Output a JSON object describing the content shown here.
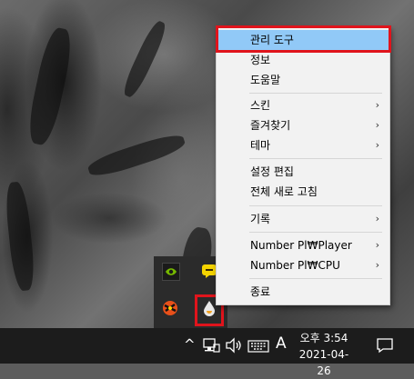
{
  "context_menu": {
    "items": [
      {
        "label": "관리 도구",
        "submenu": false,
        "highlighted": true
      },
      {
        "label": "정보",
        "submenu": false
      },
      {
        "label": "도움말",
        "submenu": false
      },
      {
        "label": "스킨",
        "submenu": true
      },
      {
        "label": "즐겨찾기",
        "submenu": true
      },
      {
        "label": "테마",
        "submenu": true
      },
      {
        "label": "설정 편집",
        "submenu": false
      },
      {
        "label": "전체 새로 고침",
        "submenu": false
      },
      {
        "label": "기록",
        "submenu": true
      },
      {
        "label": "Number Pl₩Player",
        "submenu": true
      },
      {
        "label": "Number Pl₩CPU",
        "submenu": true
      },
      {
        "label": "종료",
        "submenu": false
      }
    ],
    "submenu_arrow": "›",
    "highlight_color": "#91c9f7"
  },
  "taskbar": {
    "chevron": "^",
    "ime_indicator": "A",
    "time": "오후 3:54",
    "date": "2021-04-26"
  },
  "tray_overflow_icons": [
    "nvidia-icon",
    "chat-bubble-icon",
    "colorful-app-icon",
    "raindrop-app-icon"
  ],
  "annotation_color": "#e0141c"
}
